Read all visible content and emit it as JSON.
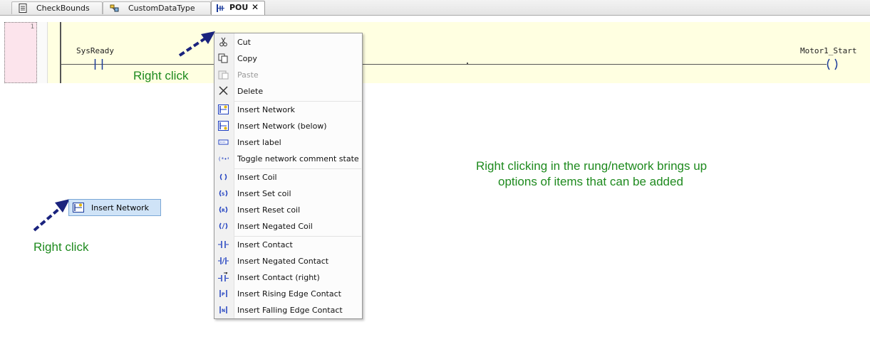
{
  "tabs": [
    {
      "label": "CheckBounds",
      "icon": "document-icon",
      "active": false
    },
    {
      "label": "CustomDataType",
      "icon": "datatype-icon",
      "active": false
    },
    {
      "label": "POU",
      "icon": "ladder-pou-icon",
      "active": true,
      "close": "✕"
    }
  ],
  "network": {
    "number": "1",
    "contact_variable": "SysReady",
    "coil_variable": "Motor1_Start"
  },
  "annotations": {
    "right_click_top": "Right click",
    "right_click_left": "Right click",
    "description_line1": "Right clicking in the rung/network brings up",
    "description_line2": "options of items that can be added"
  },
  "floating_item": {
    "label": "Insert Network",
    "icon": "insert-network-icon"
  },
  "context_menu": {
    "items": [
      {
        "label": "Cut",
        "icon": "cut-icon",
        "enabled": true
      },
      {
        "label": "Copy",
        "icon": "copy-icon",
        "enabled": true
      },
      {
        "label": "Paste",
        "icon": "paste-icon",
        "enabled": false
      },
      {
        "label": "Delete",
        "icon": "delete-icon",
        "enabled": true
      },
      {
        "label": "Insert Network",
        "icon": "insert-network-icon",
        "enabled": true
      },
      {
        "label": "Insert Network (below)",
        "icon": "insert-network-below-icon",
        "enabled": true
      },
      {
        "label": "Insert label",
        "icon": "insert-label-icon",
        "enabled": true
      },
      {
        "label": "Toggle network comment state",
        "icon": "toggle-comment-icon",
        "enabled": true
      },
      {
        "label": "Insert Coil",
        "icon": "coil-icon",
        "enabled": true
      },
      {
        "label": "Insert Set coil",
        "icon": "set-coil-icon",
        "enabled": true
      },
      {
        "label": "Insert Reset coil",
        "icon": "reset-coil-icon",
        "enabled": true
      },
      {
        "label": "Insert Negated Coil",
        "icon": "negated-coil-icon",
        "enabled": true
      },
      {
        "label": "Insert Contact",
        "icon": "contact-icon",
        "enabled": true
      },
      {
        "label": "Insert Negated Contact",
        "icon": "negated-contact-icon",
        "enabled": true
      },
      {
        "label": "Insert Contact (right)",
        "icon": "contact-right-icon",
        "enabled": true
      },
      {
        "label": "Insert Rising Edge Contact",
        "icon": "rising-edge-contact-icon",
        "enabled": true
      },
      {
        "label": "Insert Falling Edge Contact",
        "icon": "falling-edge-contact-icon",
        "enabled": true
      }
    ]
  },
  "colors": {
    "network_background": "#ffffe1",
    "annotation_green": "#1e8a1e",
    "arrow_blue": "#1a237e",
    "menu_icon_blue": "#2040c0"
  }
}
